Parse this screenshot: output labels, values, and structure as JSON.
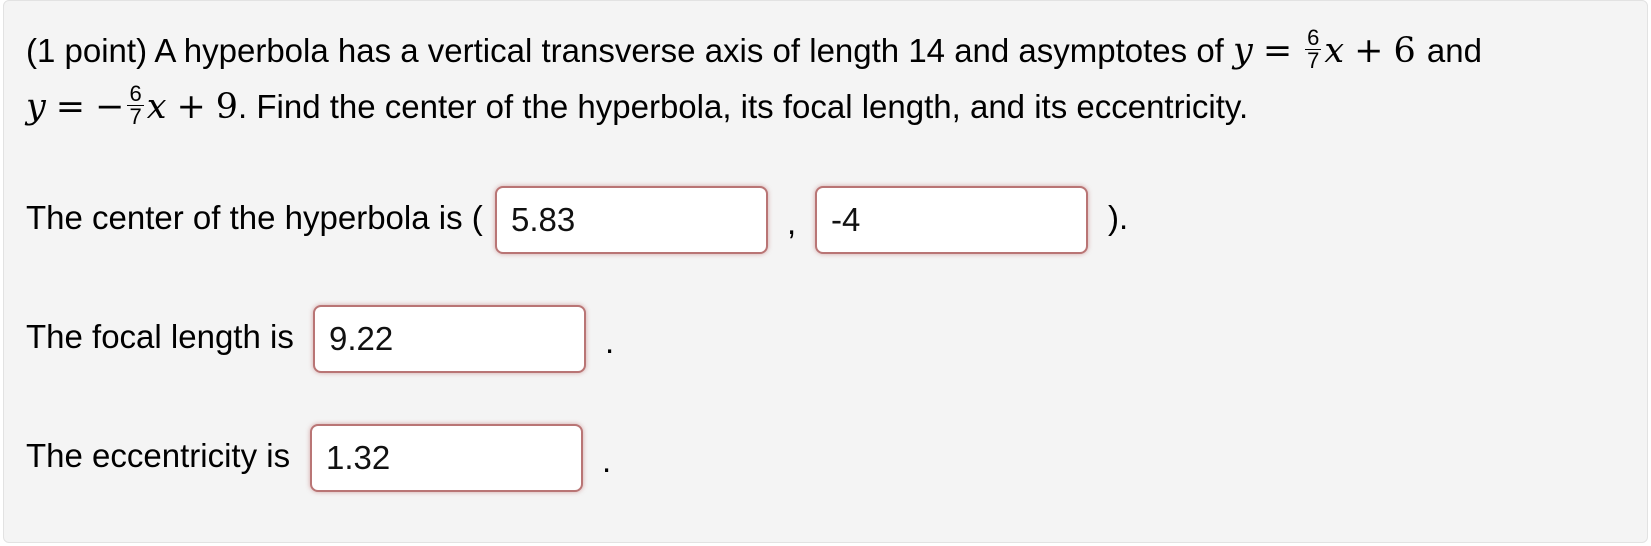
{
  "problem": {
    "line1_text": "(1 point) A hyperbola has a vertical transverse axis of length 14 and asymptotes of",
    "eq1": {
      "lhs": "y",
      "eq": "=",
      "num": "6",
      "den": "7",
      "var": "x",
      "plus": "+",
      "const": "6"
    },
    "and_text": "and",
    "eq2": {
      "lhs": "y",
      "eq": "=",
      "sign": "−",
      "num": "6",
      "den": "7",
      "var": "x",
      "plus": "+",
      "const": "9"
    },
    "line2_text": ". Find the center of the hyperbola, its focal length, and its eccentricity."
  },
  "center": {
    "label": "The center of the hyperbola is (",
    "x_value": "5.83",
    "comma": ",",
    "y_value": "-4",
    "close": ")."
  },
  "focal": {
    "label": "The focal length is",
    "value": "9.22",
    "period": "."
  },
  "eccentricity": {
    "label": "The eccentricity is",
    "value": "1.32",
    "period": "."
  }
}
